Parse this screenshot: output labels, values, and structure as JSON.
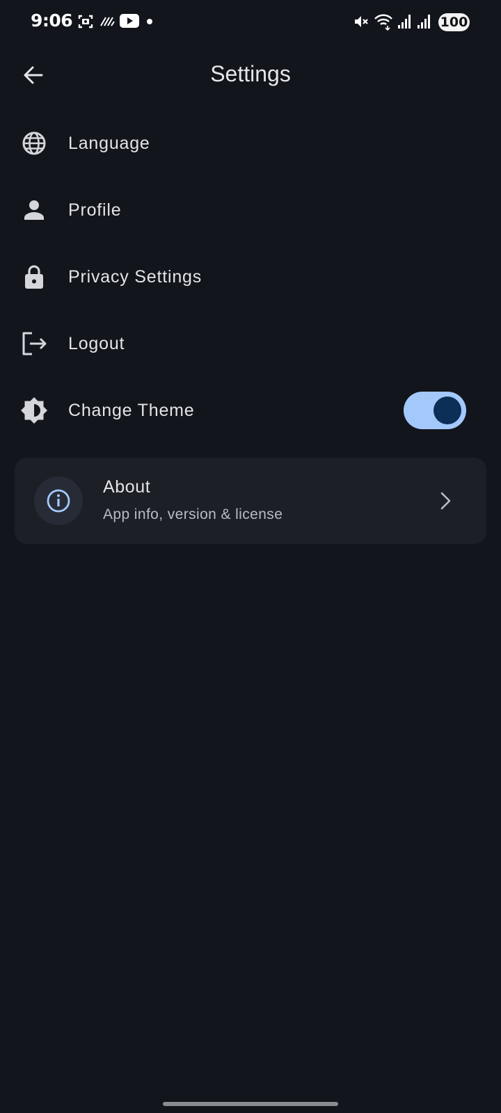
{
  "status_bar": {
    "time": "9:06",
    "battery": "100",
    "icons": [
      "screenshot-icon",
      "stripes-icon",
      "youtube-icon",
      "dot-icon",
      "mute-icon",
      "wifi-icon",
      "signal-icon",
      "signal-icon-2"
    ]
  },
  "app_bar": {
    "title": "Settings",
    "back_icon": "arrow-back-icon"
  },
  "settings": {
    "items": [
      {
        "label": "Language",
        "icon": "globe-icon"
      },
      {
        "label": "Profile",
        "icon": "person-icon"
      },
      {
        "label": "Privacy Settings",
        "icon": "lock-icon"
      },
      {
        "label": "Logout",
        "icon": "logout-icon"
      },
      {
        "label": "Change Theme",
        "icon": "brightness-icon",
        "toggle_on": true
      }
    ]
  },
  "about": {
    "title": "About",
    "subtitle": "App info, version & license",
    "icon": "info-icon",
    "chevron_icon": "chevron-right-icon"
  },
  "colors": {
    "background": "#12151b",
    "card": "#1c1f26",
    "accent": "#a3c9fb",
    "toggle_knob": "#0b2f57",
    "text": "#e4e4e8"
  }
}
